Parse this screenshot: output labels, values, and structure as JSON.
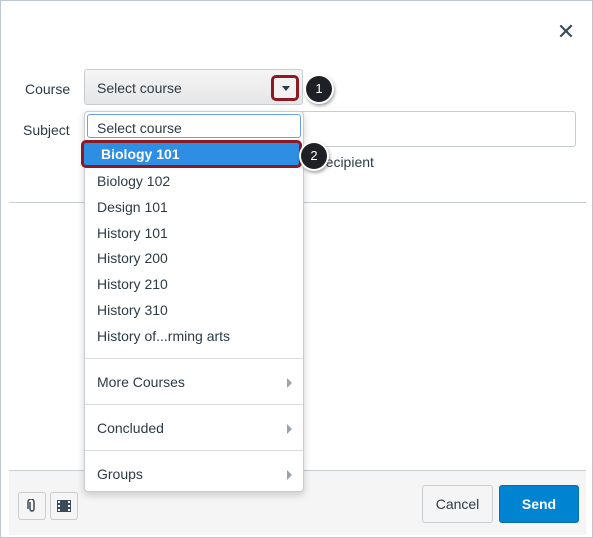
{
  "dialog": {
    "close_glyph": "✕"
  },
  "form": {
    "course_label": "Course",
    "course_value": "Select course",
    "subject_label": "Subject",
    "behind_recipient_text": "recipient"
  },
  "callouts": {
    "one": "1",
    "two": "2"
  },
  "menu": {
    "items": [
      "Select course",
      "Biology 101",
      "Biology 102",
      "Design 101",
      "History 101",
      "History 200",
      "History 210",
      "History 310",
      "History of...rming arts"
    ],
    "selected_index": 1,
    "more_courses": "More Courses",
    "concluded": "Concluded",
    "groups": "Groups"
  },
  "footer": {
    "attach_icon": "paperclip-icon",
    "media_icon": "film-icon",
    "cancel_label": "Cancel",
    "send_label": "Send"
  },
  "colors": {
    "accent": "#0084d1",
    "highlight": "#2d8ee3",
    "annotation_border": "#8b1a22"
  }
}
